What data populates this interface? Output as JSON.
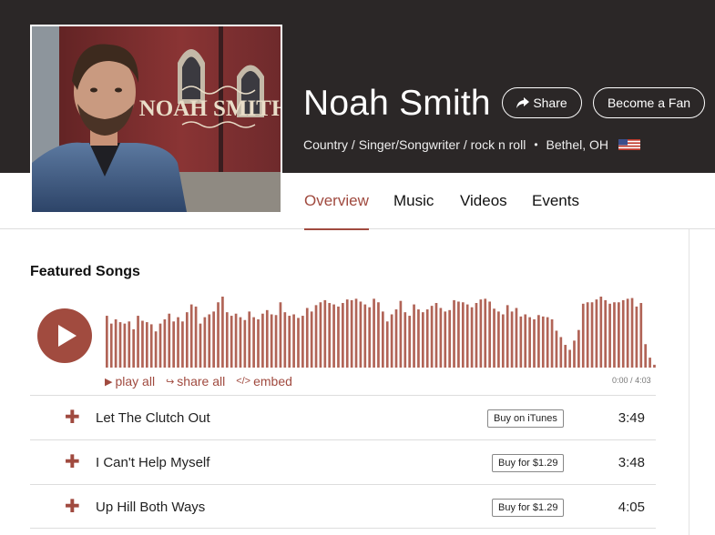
{
  "artist": {
    "name": "Noah Smith",
    "photo_text": "NOAH SMITH",
    "genres": "Country / Singer/Songwriter / rock n roll",
    "separator": "•",
    "location": "Bethel, OH",
    "flag_icon": "us-flag-icon"
  },
  "header_buttons": {
    "share_label": "Share",
    "fan_label": "Become a Fan"
  },
  "nav": {
    "tabs": [
      {
        "label": "Overview",
        "active": true
      },
      {
        "label": "Music",
        "active": false
      },
      {
        "label": "Videos",
        "active": false
      },
      {
        "label": "Events",
        "active": false
      }
    ]
  },
  "featured": {
    "title": "Featured Songs",
    "play_all": "play all",
    "share_all": "share all",
    "embed": "embed",
    "current_time": "0:00",
    "time_separator": "/",
    "total_time": "4:03"
  },
  "songs": [
    {
      "title": "Let The Clutch Out",
      "buy_label": "Buy on iTunes",
      "duration": "3:49"
    },
    {
      "title": "I Can't Help Myself",
      "buy_label": "Buy for $1.29",
      "duration": "3:48"
    },
    {
      "title": "Up Hill Both Ways",
      "buy_label": "Buy for $1.29",
      "duration": "4:05"
    }
  ],
  "waveform_levels": [
    0.73,
    0.62,
    0.68,
    0.64,
    0.62,
    0.65,
    0.54,
    0.73,
    0.66,
    0.64,
    0.61,
    0.51,
    0.62,
    0.68,
    0.76,
    0.65,
    0.71,
    0.65,
    0.78,
    0.89,
    0.86,
    0.62,
    0.71,
    0.75,
    0.79,
    0.92,
    1.0,
    0.78,
    0.73,
    0.76,
    0.71,
    0.67,
    0.79,
    0.71,
    0.68,
    0.76,
    0.81,
    0.75,
    0.74,
    0.92,
    0.78,
    0.73,
    0.75,
    0.7,
    0.73,
    0.84,
    0.79,
    0.88,
    0.92,
    0.95,
    0.91,
    0.89,
    0.86,
    0.91,
    0.96,
    0.95,
    0.97,
    0.93,
    0.89,
    0.85,
    0.97,
    0.92,
    0.79,
    0.65,
    0.75,
    0.82,
    0.94,
    0.78,
    0.73,
    0.89,
    0.82,
    0.78,
    0.82,
    0.87,
    0.91,
    0.84,
    0.79,
    0.81,
    0.95,
    0.93,
    0.92,
    0.89,
    0.85,
    0.91,
    0.96,
    0.97,
    0.93,
    0.83,
    0.79,
    0.75,
    0.88,
    0.79,
    0.84,
    0.72,
    0.75,
    0.71,
    0.68,
    0.74,
    0.72,
    0.71,
    0.68,
    0.52,
    0.43,
    0.32,
    0.25,
    0.38,
    0.53,
    0.9,
    0.92,
    0.92,
    0.96,
    1.0,
    0.95,
    0.9,
    0.92,
    0.92,
    0.95,
    0.97,
    0.98,
    0.86,
    0.91,
    0.33,
    0.14,
    0.04
  ],
  "colors": {
    "accent": "#a04a3f",
    "header_bg": "#2b2727",
    "waveform": "#b16457"
  }
}
